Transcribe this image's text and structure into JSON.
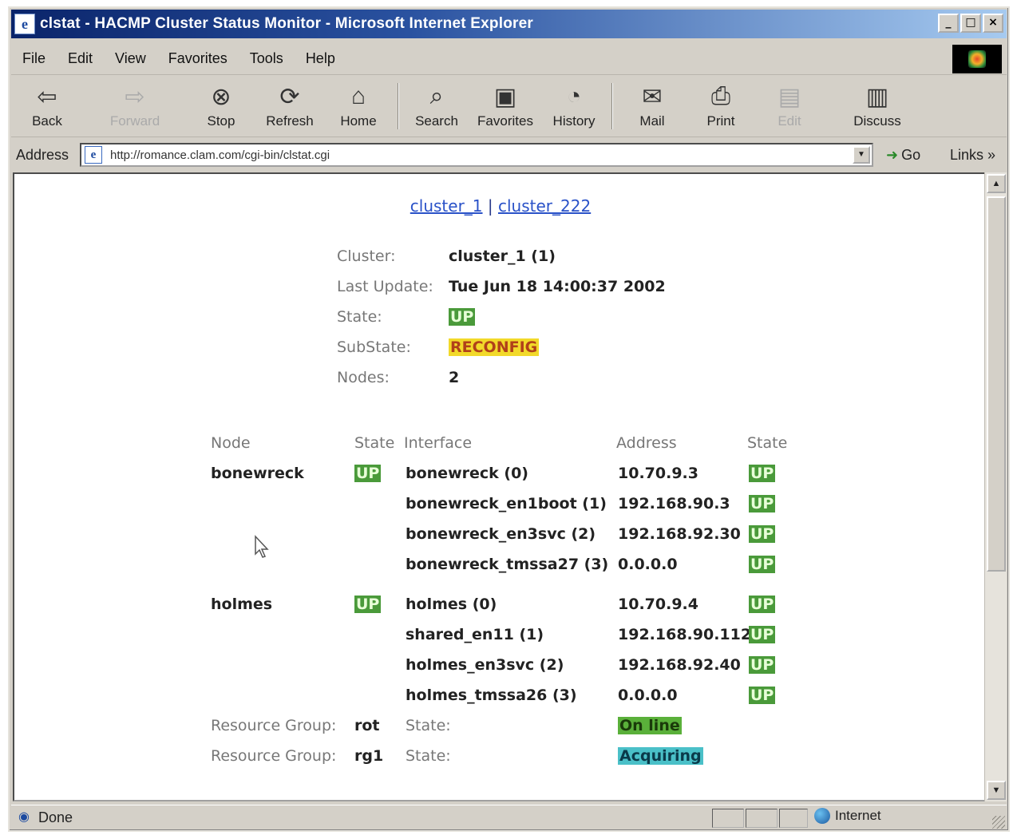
{
  "window": {
    "title": "clstat - HACMP Cluster Status Monitor - Microsoft Internet Explorer",
    "buttons": [
      "_",
      "□",
      "×"
    ]
  },
  "menu": [
    "File",
    "Edit",
    "View",
    "Favorites",
    "Tools",
    "Help"
  ],
  "toolbar": {
    "back": "Back",
    "forward": "Forward",
    "stop": "Stop",
    "refresh": "Refresh",
    "home": "Home",
    "search": "Search",
    "favorites": "Favorites",
    "history": "History",
    "mail": "Mail",
    "print": "Print",
    "edit": "Edit",
    "discuss": "Discuss"
  },
  "address": {
    "label": "Address",
    "url": "http://romance.clam.com/cgi-bin/clstat.cgi",
    "go": "Go",
    "links": "Links »"
  },
  "page": {
    "cluster_link_1": "cluster_1",
    "separator": "|",
    "cluster_link_2": "cluster_222",
    "summary": {
      "cluster_label": "Cluster:",
      "cluster_value": "cluster_1 (1)",
      "update_label": "Last Update:",
      "update_value": "Tue Jun 18 14:00:37 2002",
      "state_label": "State:",
      "state_value": "UP",
      "substate_label": "SubState:",
      "substate_value": "RECONFIG",
      "nodes_label": "Nodes:",
      "nodes_value": "2"
    },
    "headers": {
      "node": "Node",
      "state": "State",
      "interface": "Interface",
      "address": "Address",
      "istate": "State"
    },
    "nodes": [
      {
        "name": "bonewreck",
        "state": "UP",
        "interfaces": [
          {
            "name": "bonewreck (0)",
            "address": "10.70.9.3",
            "state": "UP"
          },
          {
            "name": "bonewreck_en1boot (1)",
            "address": "192.168.90.3",
            "state": "UP"
          },
          {
            "name": "bonewreck_en3svc (2)",
            "address": "192.168.92.30",
            "state": "UP"
          },
          {
            "name": "bonewreck_tmssa27 (3)",
            "address": "0.0.0.0",
            "state": "UP"
          }
        ]
      },
      {
        "name": "holmes",
        "state": "UP",
        "interfaces": [
          {
            "name": "holmes (0)",
            "address": "10.70.9.4",
            "state": "UP"
          },
          {
            "name": "shared_en11 (1)",
            "address": "192.168.90.112",
            "state": "UP"
          },
          {
            "name": "holmes_en3svc (2)",
            "address": "192.168.92.40",
            "state": "UP"
          },
          {
            "name": "holmes_tmssa26 (3)",
            "address": "0.0.0.0",
            "state": "UP"
          }
        ]
      }
    ],
    "resource_groups": [
      {
        "label": "Resource Group:",
        "name": "rot",
        "state_label": "State:",
        "state": "On line"
      },
      {
        "label": "Resource Group:",
        "name": "rg1",
        "state_label": "State:",
        "state": "Acquiring"
      }
    ]
  },
  "status": {
    "text": "Done",
    "zone": "Internet"
  }
}
